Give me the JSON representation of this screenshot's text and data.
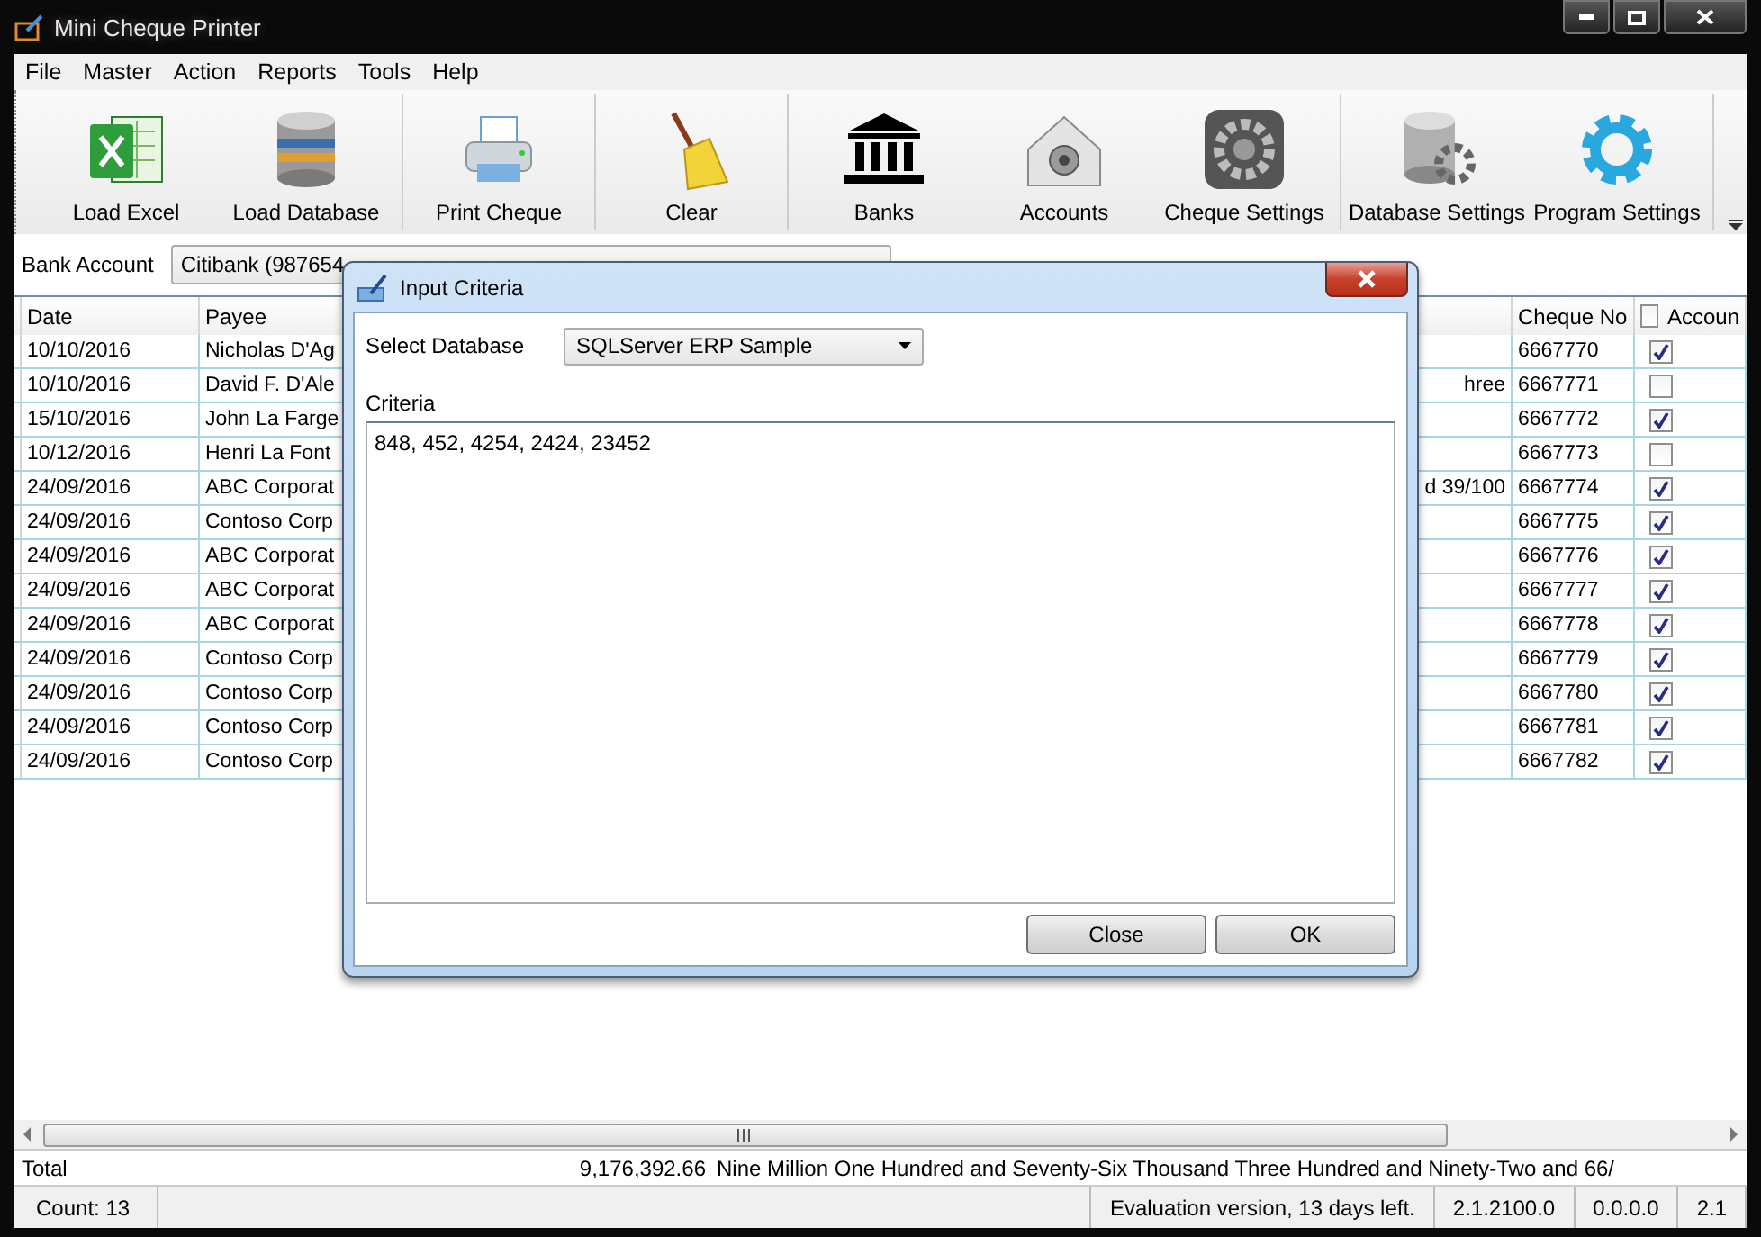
{
  "window": {
    "title": "Mini Cheque Printer"
  },
  "menu": [
    "File",
    "Master",
    "Action",
    "Reports",
    "Tools",
    "Help"
  ],
  "toolbar": [
    [
      {
        "label": "Load Excel",
        "kind": "excel"
      },
      {
        "label": "Load Database",
        "kind": "database"
      }
    ],
    [
      {
        "label": "Print Cheque",
        "kind": "printer"
      }
    ],
    [
      {
        "label": "Clear",
        "kind": "broom"
      }
    ],
    [
      {
        "label": "Banks",
        "kind": "bank"
      },
      {
        "label": "Accounts",
        "kind": "house"
      },
      {
        "label": "Cheque Settings",
        "kind": "gearbox"
      }
    ],
    [
      {
        "label": "Database Settings",
        "kind": "dbgear"
      },
      {
        "label": "Program Settings",
        "kind": "gear"
      }
    ]
  ],
  "bank_account": {
    "label": "Bank Account",
    "value": "Citibank (987654"
  },
  "table": {
    "columns": [
      {
        "label": "Date"
      },
      {
        "label": "Payee"
      },
      {
        "label": "Cheque No"
      },
      {
        "label": "Accoun",
        "checked": false
      }
    ],
    "rows": [
      {
        "date": "10/10/2016",
        "payee": "Nicholas D'Ag",
        "cheque_no": "6667770",
        "account": true
      },
      {
        "date": "10/10/2016",
        "payee": "David F. D'Ale",
        "column_3": "hree",
        "cheque_no": "6667771",
        "account": false
      },
      {
        "date": "15/10/2016",
        "payee": "John La Farge",
        "cheque_no": "6667772",
        "account": true
      },
      {
        "date": "10/12/2016",
        "payee": "Henri La Font",
        "cheque_no": "6667773",
        "account": false
      },
      {
        "date": "24/09/2016",
        "payee": "ABC Corporat",
        "column_3": "d 39/100",
        "cheque_no": "6667774",
        "account": true
      },
      {
        "date": "24/09/2016",
        "payee": "Contoso Corp",
        "cheque_no": "6667775",
        "account": true
      },
      {
        "date": "24/09/2016",
        "payee": "ABC Corporat",
        "cheque_no": "6667776",
        "account": true
      },
      {
        "date": "24/09/2016",
        "payee": "ABC Corporat",
        "cheque_no": "6667777",
        "account": true
      },
      {
        "date": "24/09/2016",
        "payee": "ABC Corporat",
        "cheque_no": "6667778",
        "account": true
      },
      {
        "date": "24/09/2016",
        "payee": "Contoso Corp",
        "cheque_no": "6667779",
        "account": true
      },
      {
        "date": "24/09/2016",
        "payee": "Contoso Corp",
        "cheque_no": "6667780",
        "account": true
      },
      {
        "date": "24/09/2016",
        "payee": "Contoso Corp",
        "cheque_no": "6667781",
        "account": true
      },
      {
        "date": "24/09/2016",
        "payee": "Contoso Corp",
        "cheque_no": "6667782",
        "account": true
      }
    ]
  },
  "total": {
    "label": "Total",
    "amount": "9,176,392.66",
    "words": "Nine Million One Hundred and Seventy-Six Thousand Three Hundred and Ninety-Two and 66/"
  },
  "status_bar": {
    "count": "Count: 13",
    "items": [
      "Evaluation version, 13 days left.",
      "2.1.2100.0",
      "0.0.0.0",
      "2.1"
    ]
  },
  "dialog": {
    "title": "Input Criteria",
    "select_label": "Select Database",
    "select_value": "SQLServer ERP Sample",
    "criteria_label": "Criteria",
    "criteria_value": "848, 452, 4254, 2424, 23452",
    "buttons": [
      "Close",
      "OK"
    ]
  }
}
